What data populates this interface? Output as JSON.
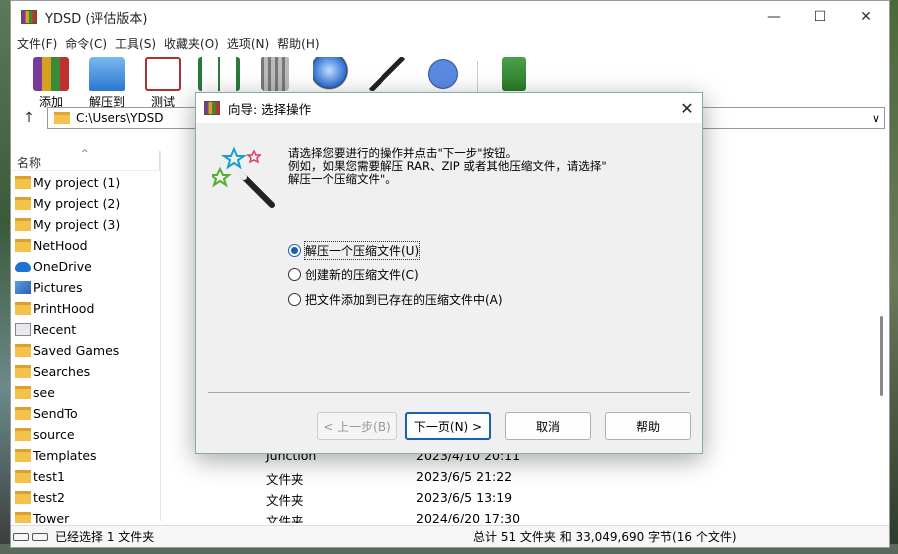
{
  "window": {
    "title": "YDSD (评估版本)"
  },
  "menu": [
    "文件(F)",
    "命令(C)",
    "工具(S)",
    "收藏夹(O)",
    "选项(N)",
    "帮助(H)"
  ],
  "toolbar": [
    {
      "label": "添加",
      "icon": "archive-add-icon"
    },
    {
      "label": "解压到",
      "icon": "extract-folder-icon"
    },
    {
      "label": "测试",
      "icon": "test-clipboard-icon"
    },
    {
      "label": "",
      "icon": "view-book-icon"
    },
    {
      "label": "",
      "icon": "delete-trash-icon"
    },
    {
      "label": "",
      "icon": "find-magnifier-icon"
    },
    {
      "label": "",
      "icon": "wizard-wand-icon"
    },
    {
      "label": "",
      "icon": "info-icon"
    },
    {
      "label": "",
      "icon": "repair-icon"
    }
  ],
  "address": {
    "path": "C:\\Users\\YDSD"
  },
  "list": {
    "header_name": "名称",
    "rows": [
      {
        "name": "My project (1)",
        "icon": "folder"
      },
      {
        "name": "My project (2)",
        "icon": "folder"
      },
      {
        "name": "My project (3)",
        "icon": "folder"
      },
      {
        "name": "NetHood",
        "icon": "folder"
      },
      {
        "name": "OneDrive",
        "icon": "cloud"
      },
      {
        "name": "Pictures",
        "icon": "pic"
      },
      {
        "name": "PrintHood",
        "icon": "folder"
      },
      {
        "name": "Recent",
        "icon": "recent"
      },
      {
        "name": "Saved Games",
        "icon": "folder"
      },
      {
        "name": "Searches",
        "icon": "folder"
      },
      {
        "name": "see",
        "icon": "folder"
      },
      {
        "name": "SendTo",
        "icon": "folder"
      },
      {
        "name": "source",
        "icon": "folder"
      },
      {
        "name": "Templates",
        "icon": "folder",
        "type": "Junction",
        "date": "2023/4/10 20:11"
      },
      {
        "name": "test1",
        "icon": "folder",
        "type": "文件夹",
        "date": "2023/6/5 21:22"
      },
      {
        "name": "test2",
        "icon": "folder",
        "type": "文件夹",
        "date": "2023/6/5 13:19"
      },
      {
        "name": "Tower",
        "icon": "folder",
        "type": "文件夹",
        "date": "2024/6/20 17:30"
      }
    ]
  },
  "status": {
    "left": "已经选择 1 文件夹",
    "right": "总计 51 文件夹 和 33,049,690 字节(16 个文件)"
  },
  "dialog": {
    "title": "向导: 选择操作",
    "instruction": "请选择您要进行的操作并点击\"下一步\"按钮。\n例如，如果您需要解压 RAR、ZIP 或者其他压缩文件，请选择\"\n解压一个压缩文件\"。",
    "options": [
      {
        "label": "解压一个压缩文件(U)",
        "checked": true
      },
      {
        "label": "创建新的压缩文件(C)",
        "checked": false
      },
      {
        "label": "把文件添加到已存在的压缩文件中(A)",
        "checked": false
      }
    ],
    "buttons": {
      "back": "< 上一步(B)",
      "next": "下一页(N) >",
      "cancel": "取消",
      "help": "帮助"
    }
  }
}
